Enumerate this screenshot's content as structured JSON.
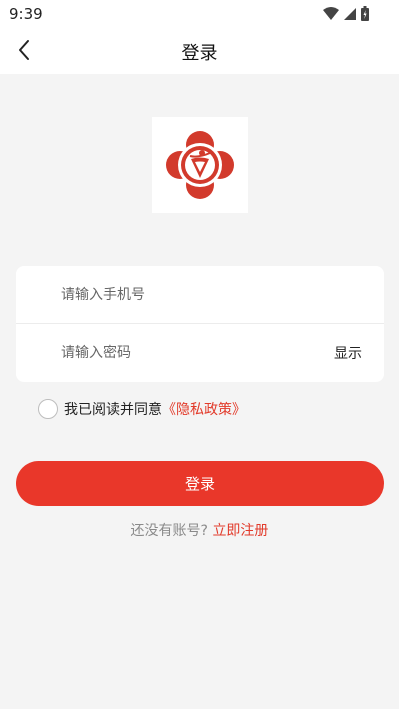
{
  "status_bar": {
    "time": "9:39",
    "icons": [
      "wifi-icon",
      "signal-icon",
      "battery-icon"
    ]
  },
  "nav": {
    "title": "登录",
    "back_icon": "chevron-left-icon"
  },
  "logo": {
    "icon": "brand-logo"
  },
  "form": {
    "phone_placeholder": "请输入手机号",
    "phone_value": "",
    "password_placeholder": "请输入密码",
    "password_value": "",
    "show_label": "显示"
  },
  "agreement": {
    "checked": false,
    "text": "我已阅读并同意",
    "policy_link": "《隐私政策》"
  },
  "login_button": "登录",
  "register": {
    "hint": "还没有账号?",
    "link": "立即注册"
  },
  "colors": {
    "accent": "#e9372a",
    "background": "#f4f4f4",
    "card": "#ffffff"
  }
}
